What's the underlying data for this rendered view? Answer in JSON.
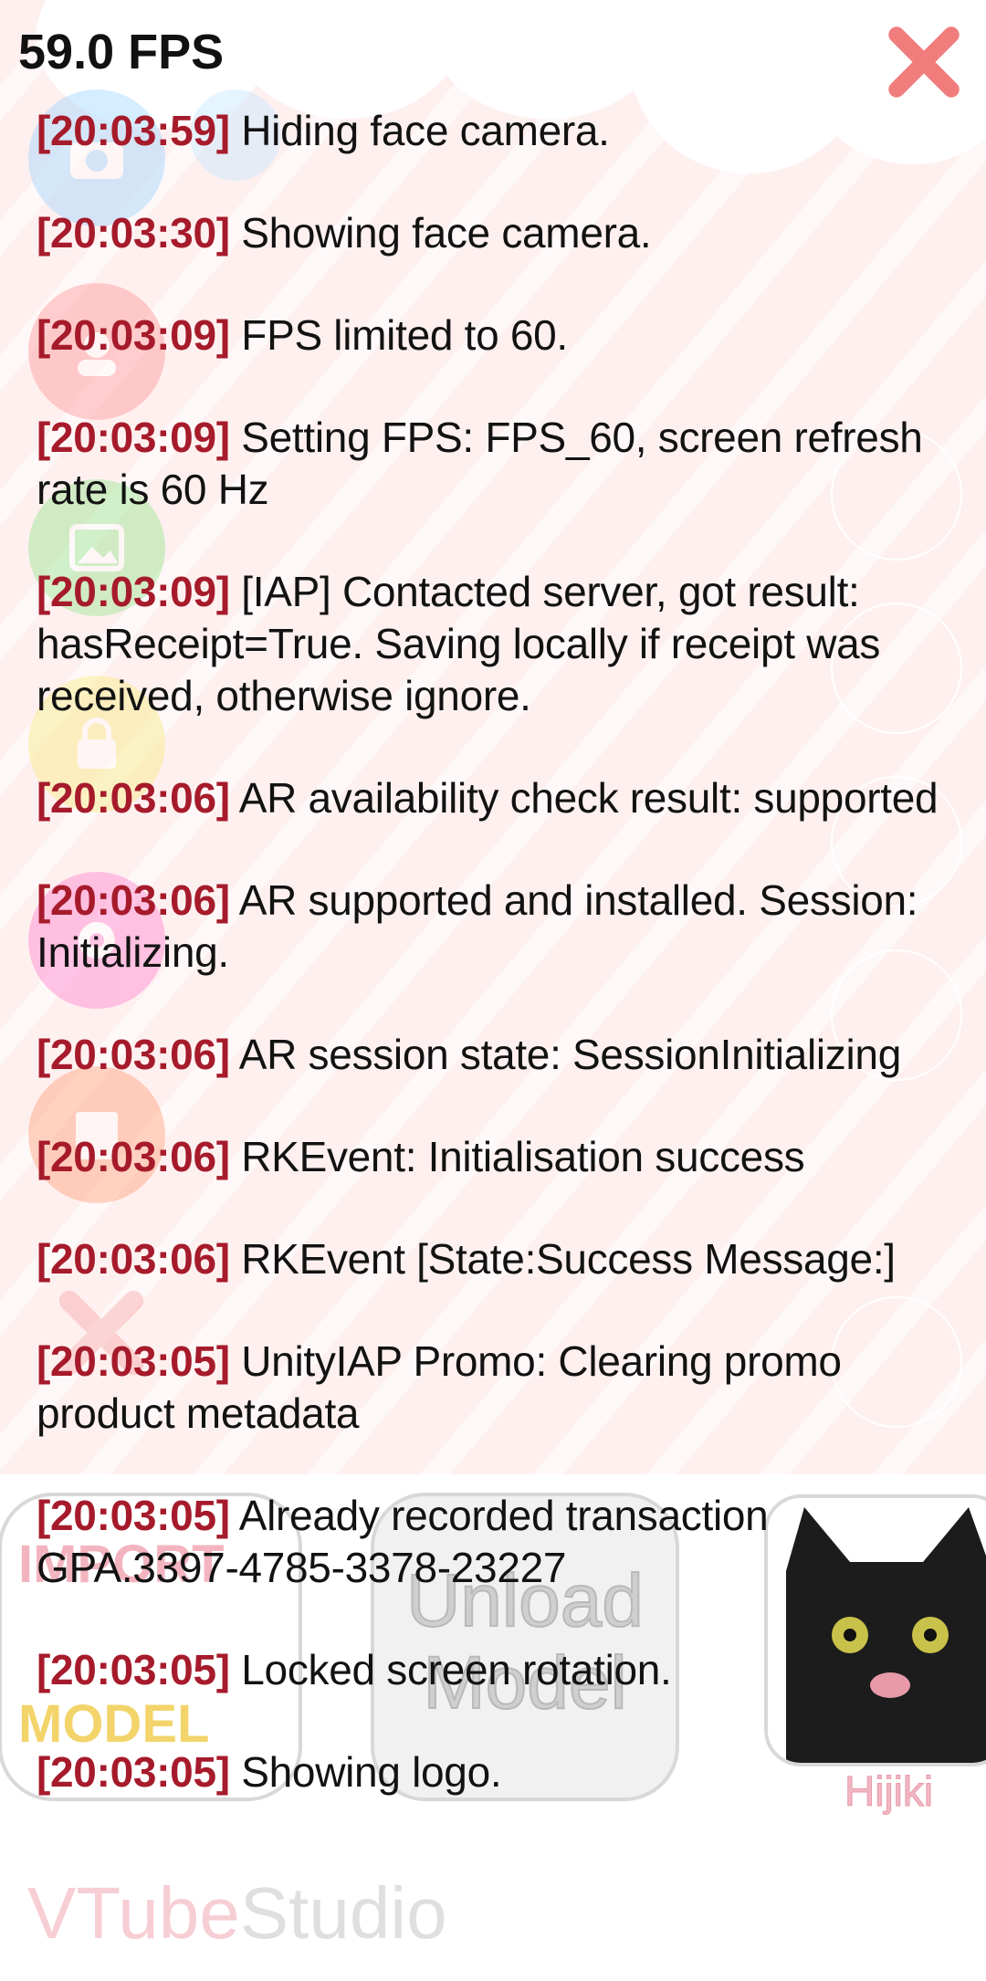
{
  "fps": "59.0 FPS",
  "log": [
    {
      "time": "[20:03:59]",
      "message": "Hiding face camera."
    },
    {
      "time": "[20:03:30]",
      "message": "Showing face camera."
    },
    {
      "time": "[20:03:09]",
      "message": "FPS limited to 60."
    },
    {
      "time": "[20:03:09]",
      "message": "Setting FPS: FPS_60, screen refresh rate is 60 Hz"
    },
    {
      "time": "[20:03:09]",
      "message": "[IAP] Contacted server, got result: hasReceipt=True. Saving locally if receipt was received, otherwise ignore."
    },
    {
      "time": "[20:03:06]",
      "message": "AR availability check result: supported"
    },
    {
      "time": "[20:03:06]",
      "message": "AR supported and installed. Session: Initializing."
    },
    {
      "time": "[20:03:06]",
      "message": "AR session state: SessionInitializing"
    },
    {
      "time": "[20:03:06]",
      "message": "RKEvent: Initialisation success"
    },
    {
      "time": "[20:03:06]",
      "message": "RKEvent [State:Success Message:]"
    },
    {
      "time": "[20:03:05]",
      "message": "UnityIAP Promo: Clearing promo product metadata"
    },
    {
      "time": "[20:03:05]",
      "message": "Already recorded transaction GPA.3397-4785-3378-23227"
    },
    {
      "time": "[20:03:05]",
      "message": "Locked screen rotation."
    },
    {
      "time": "[20:03:05]",
      "message": "Showing logo."
    }
  ],
  "background": {
    "import_card": {
      "line1": "IMPORT",
      "line2": "MODEL"
    },
    "unload_card": {
      "label": "Unload Model"
    },
    "model_name": "Hijiki",
    "brand": {
      "part1": "VTube",
      "part2": "Studio"
    }
  },
  "icons": {
    "close": "close-icon",
    "side": [
      "camera-icon",
      "face-icon",
      "image-icon",
      "lock-icon",
      "gear-icon",
      "log-icon"
    ]
  },
  "colors": {
    "timestamp": "#a61b2b",
    "close": "#f17c7c",
    "text": "#121212"
  }
}
